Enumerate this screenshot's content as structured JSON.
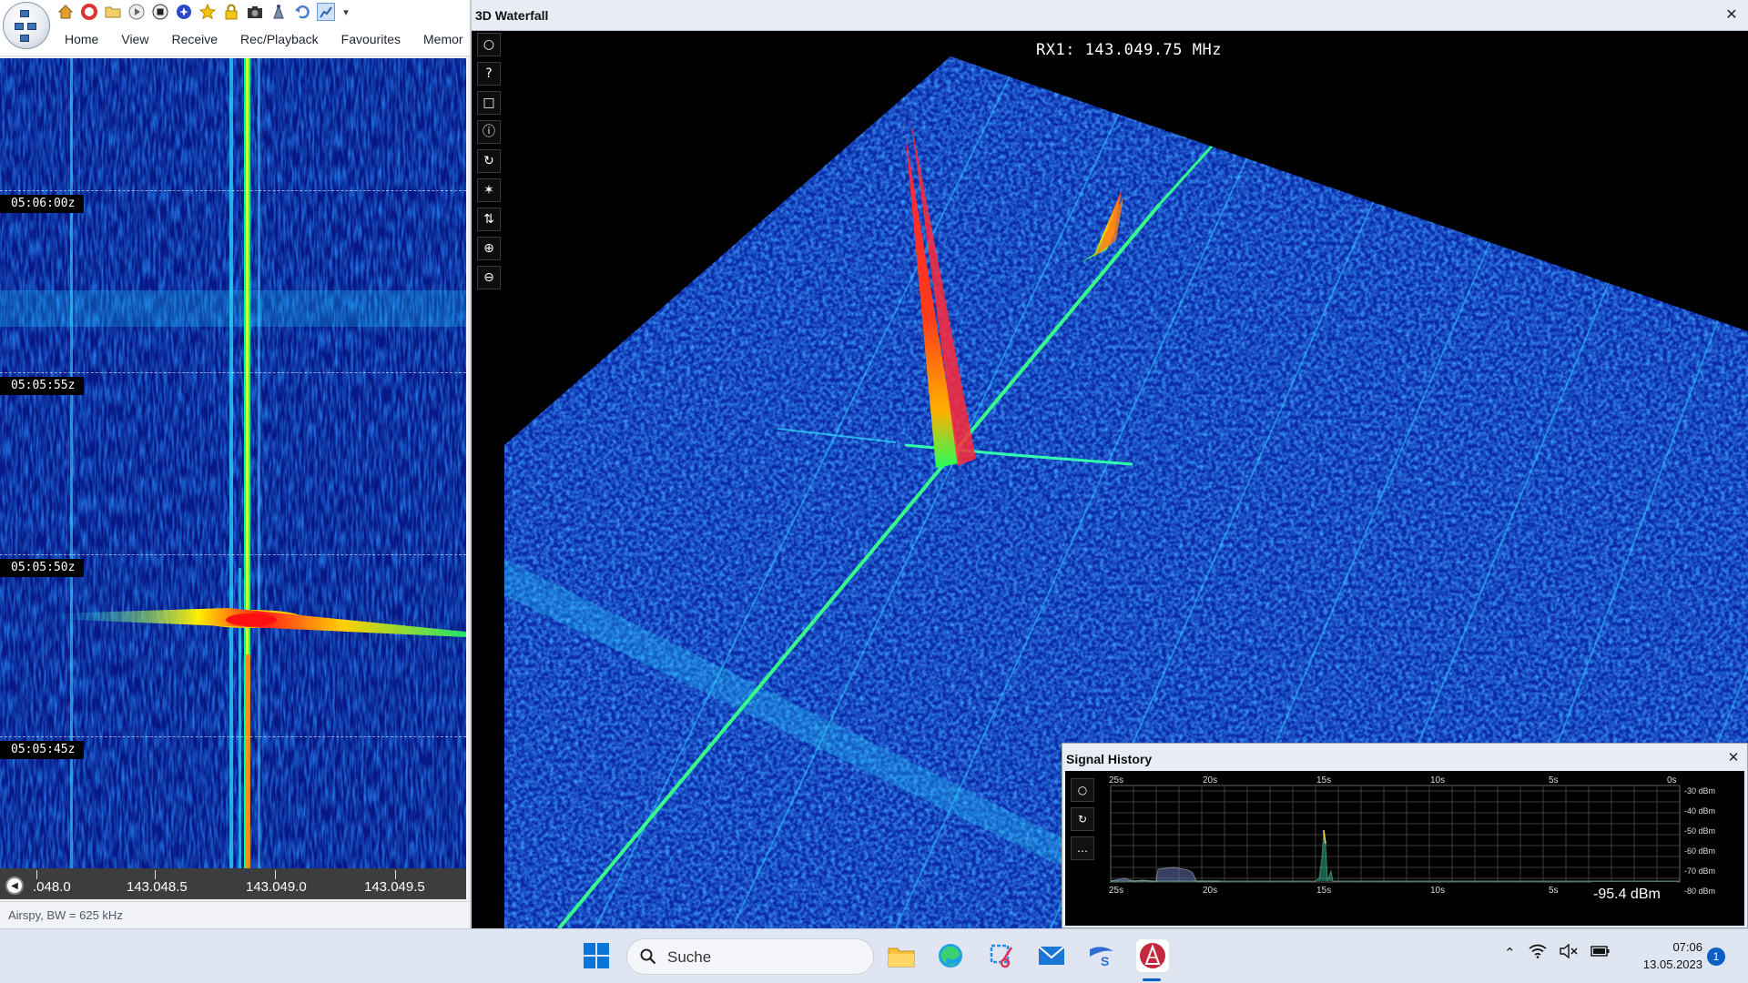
{
  "left_app": {
    "menu": [
      "Home",
      "View",
      "Receive",
      "Rec/Playback",
      "Favourites",
      "Memor"
    ],
    "quick_access_icons": [
      "home-icon",
      "lifebuoy-icon",
      "folder-icon",
      "play-icon",
      "stop-icon",
      "record-icon",
      "star-icon",
      "lock-icon",
      "camera-icon",
      "antenna-icon",
      "undo-icon",
      "chart-icon",
      "dropdown-icon"
    ],
    "waterfall": {
      "time_labels": [
        "05:06:00z",
        "05:05:55z",
        "05:05:50z",
        "05:05:45z"
      ]
    },
    "frequency_scale": {
      "labels": [
        ".048.0",
        "143.048.5",
        "143.049.0",
        "143.049.5"
      ]
    },
    "status": "Airspy, BW = 625 kHz"
  },
  "window_3d": {
    "title": "3D Waterfall",
    "rx_label": "RX1: 143.049.75 MHz",
    "toolbar_icons": [
      "circle-icon",
      "help-icon",
      "square-icon",
      "info-icon",
      "rotate-icon",
      "asterisk-icon",
      "swap-vertical-icon",
      "zoom-in-icon",
      "zoom-out-icon"
    ]
  },
  "signal_history": {
    "title": "Signal History",
    "time_labels": [
      "25s",
      "20s",
      "15s",
      "10s",
      "5s",
      "0s"
    ],
    "dbm_labels": [
      "-30 dBm",
      "-40 dBm",
      "-50 dBm",
      "-60 dBm",
      "-70 dBm",
      "-80 dBm"
    ],
    "current_reading": "-95.4 dBm",
    "tool_icons": [
      "circle-icon",
      "rotate-icon",
      "more-icon"
    ]
  },
  "taskbar": {
    "search_placeholder": "Suche",
    "time": "07:06",
    "date": "13.05.2023",
    "notification_count": "1",
    "apps": [
      "file-explorer-icon",
      "edge-icon",
      "snipping-tool-icon",
      "mail-icon",
      "sdr-logo-icon",
      "sdr-console-icon"
    ]
  }
}
